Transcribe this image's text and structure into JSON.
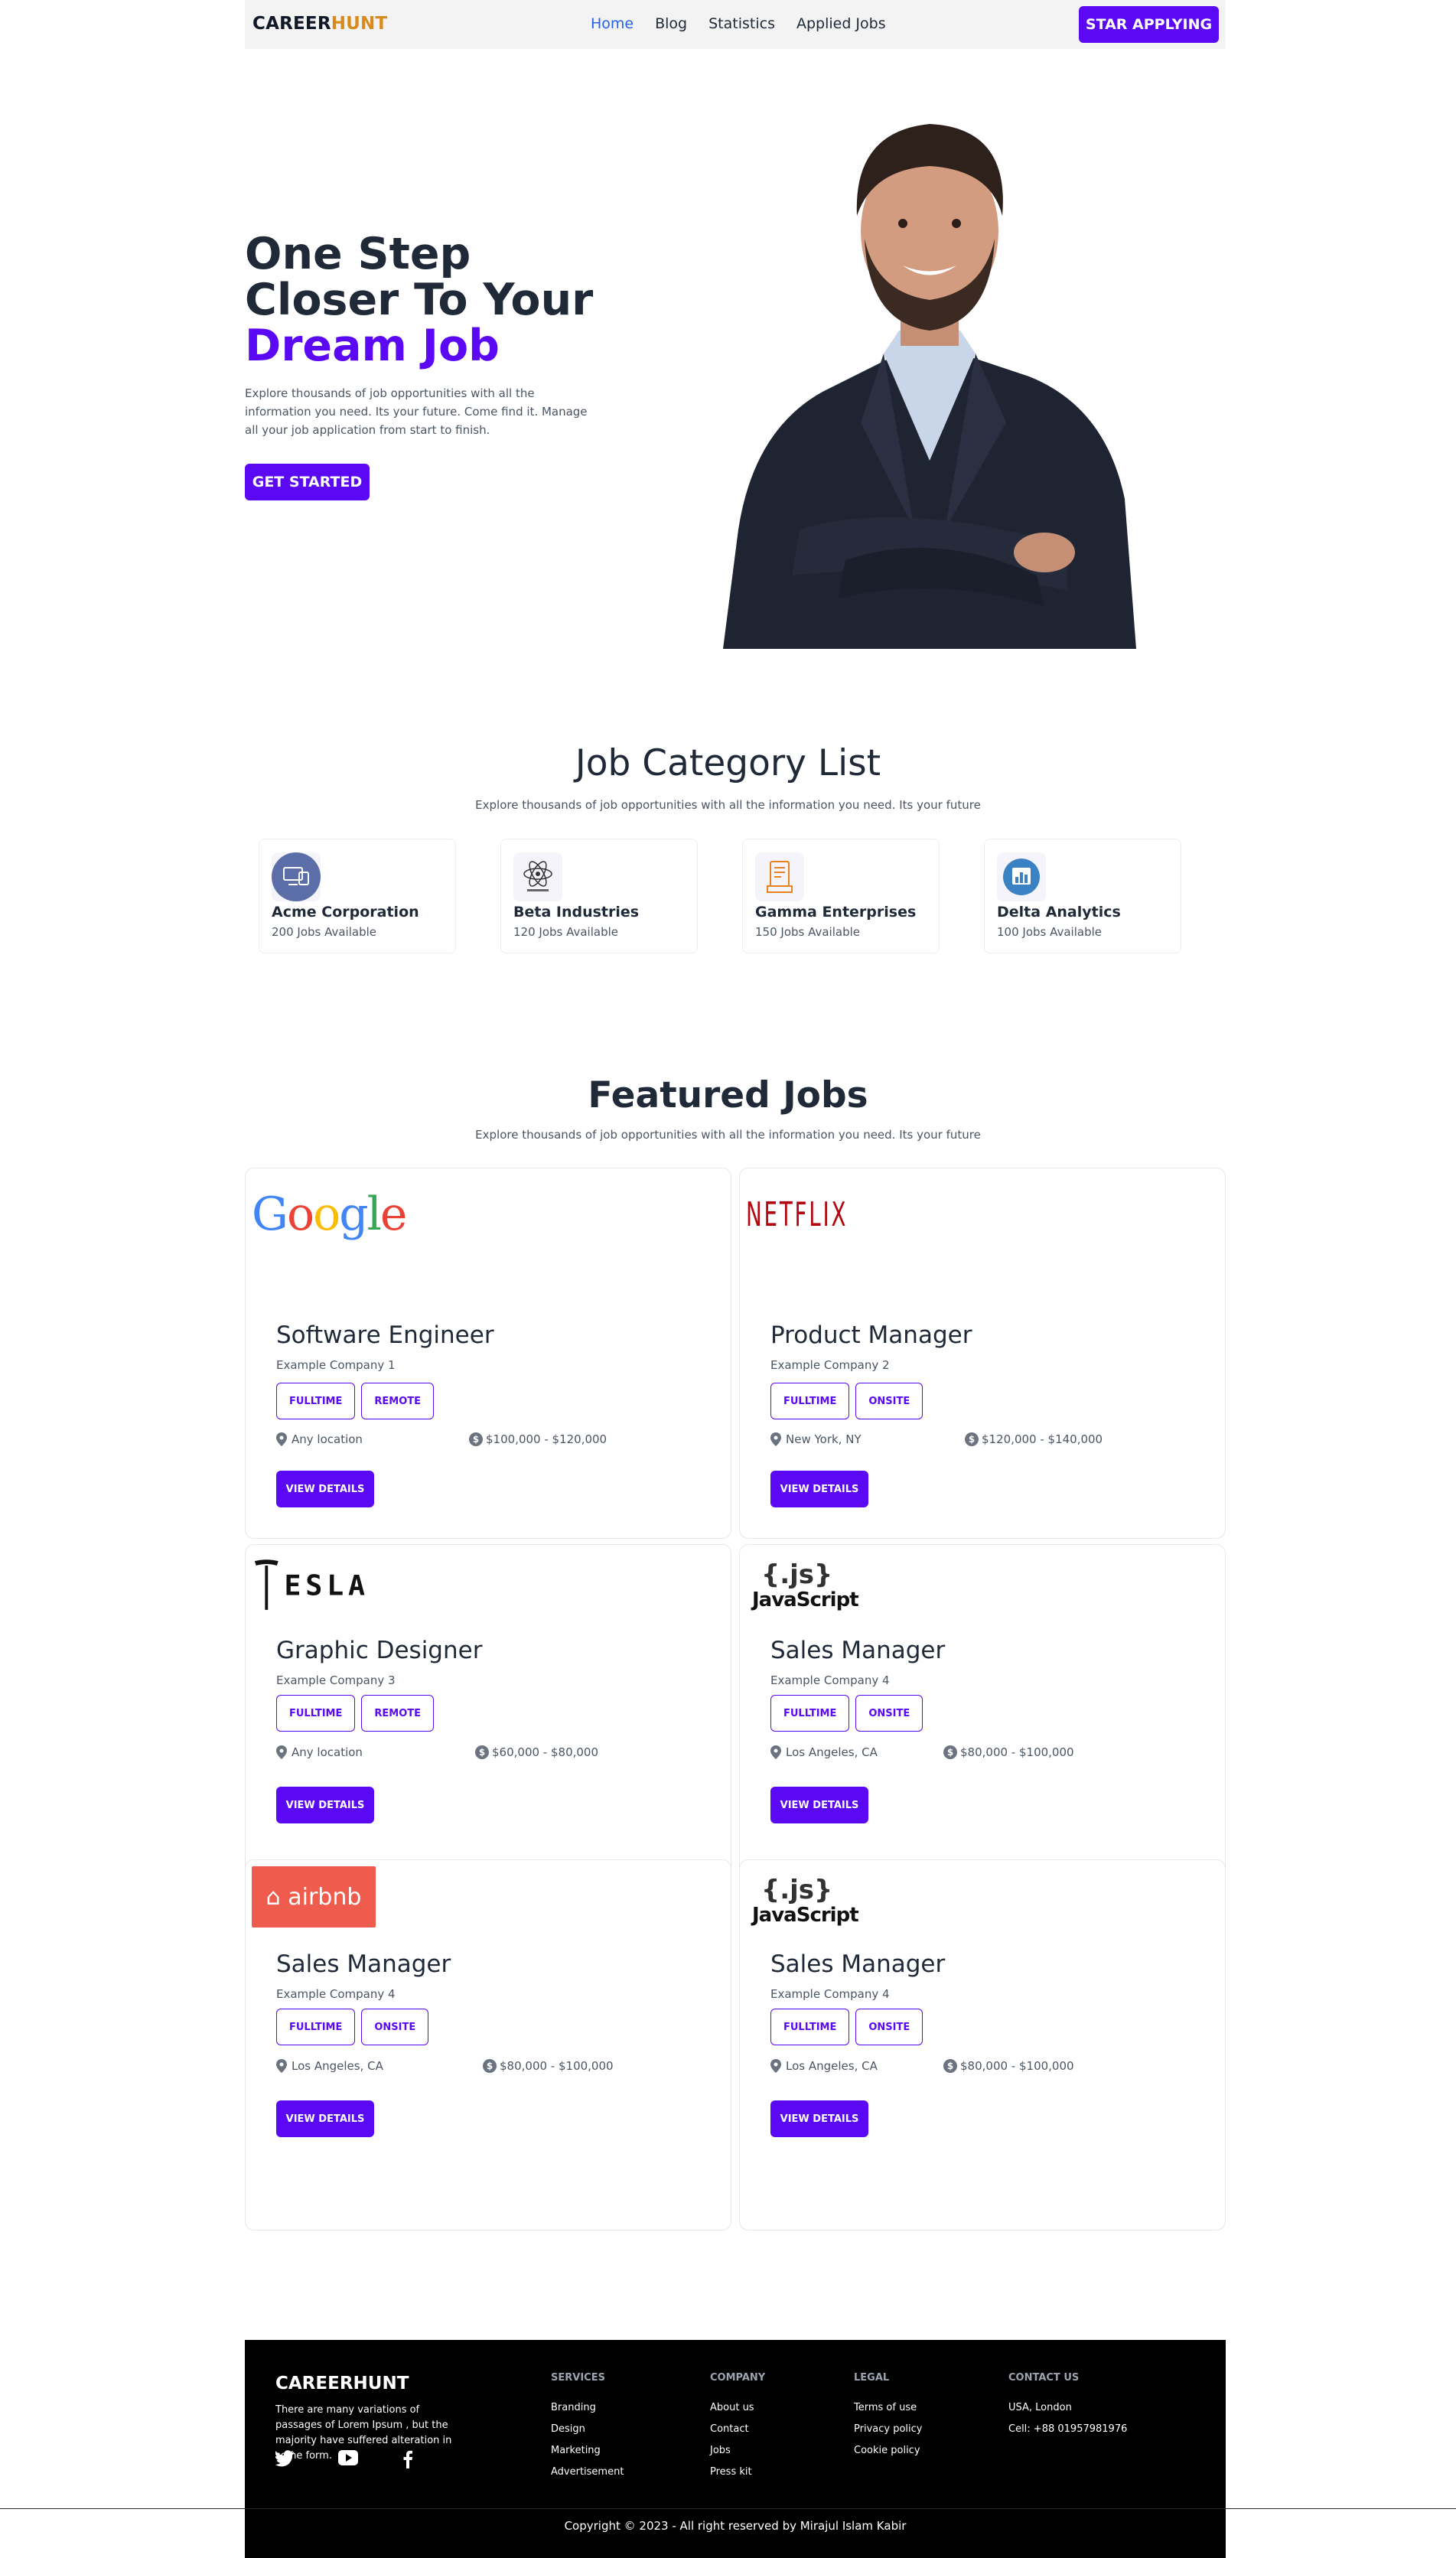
{
  "nav": {
    "logo_part1": "CAREER",
    "logo_part2": "HUNT",
    "links": [
      "Home",
      "Blog",
      "Statistics",
      "Applied Jobs"
    ],
    "cta": "STAR APPLYING"
  },
  "hero": {
    "title_line1": "One Step",
    "title_line2": "Closer To Your",
    "title_accent": "Dream Job",
    "description": "Explore thousands of job opportunities with all the information you need. Its your future. Come find it. Manage all your job application from start to finish.",
    "cta": "GET STARTED"
  },
  "categories": {
    "title": "Job Category List",
    "subtitle": "Explore thousands of job opportunities with all the information you need. Its your future",
    "items": [
      {
        "name": "Acme Corporation",
        "count": "200 Jobs Available",
        "icon": "monitor-icon"
      },
      {
        "name": "Beta Industries",
        "count": "120 Jobs Available",
        "icon": "atom-icon"
      },
      {
        "name": "Gamma Enterprises",
        "count": "150 Jobs Available",
        "icon": "document-icon"
      },
      {
        "name": "Delta Analytics",
        "count": "100 Jobs Available",
        "icon": "chart-icon"
      }
    ]
  },
  "featured": {
    "title": "Featured Jobs",
    "subtitle": "Explore thousands of job opportunities with all the information you need. Its your future",
    "details_label": "VIEW DETAILS",
    "jobs": [
      {
        "logo": "Google",
        "title": "Software Engineer",
        "company": "Example Company 1",
        "tags": [
          "FULLTIME",
          "REMOTE"
        ],
        "location": "Any location",
        "salary": "$100,000 - $120,000"
      },
      {
        "logo": "NETFLIX",
        "title": "Product Manager",
        "company": "Example Company 2",
        "tags": [
          "FULLTIME",
          "ONSITE"
        ],
        "location": "New York, NY",
        "salary": "$120,000 - $140,000"
      },
      {
        "logo": "TESLA",
        "title": "Graphic Designer",
        "company": "Example Company 3",
        "tags": [
          "FULLTIME",
          "REMOTE"
        ],
        "location": "Any location",
        "salary": "$60,000 - $80,000"
      },
      {
        "logo": "{.js} JavaScript",
        "title": "Sales Manager",
        "company": "Example Company 4",
        "tags": [
          "FULLTIME",
          "ONSITE"
        ],
        "location": "Los Angeles, CA",
        "salary": "$80,000 - $100,000"
      },
      {
        "logo": "airbnb",
        "title": "Sales Manager",
        "company": "Example Company 4",
        "tags": [
          "FULLTIME",
          "ONSITE"
        ],
        "location": "Los Angeles, CA",
        "salary": "$80,000 - $100,000"
      },
      {
        "logo": "{.js} JavaScript",
        "title": "Sales Manager",
        "company": "Example Company 4",
        "tags": [
          "FULLTIME",
          "ONSITE"
        ],
        "location": "Los Angeles, CA",
        "salary": "$80,000 - $100,000"
      }
    ]
  },
  "footer": {
    "brand": "CAREERHUNT",
    "description": "There are many variations of passages of Lorem Ipsum , but the majority have suffered alteration in some form.",
    "columns": [
      {
        "heading": "SERVICES",
        "items": [
          "Branding",
          "Design",
          "Marketing",
          "Advertisement"
        ]
      },
      {
        "heading": "COMPANY",
        "items": [
          "About us",
          "Contact",
          "Jobs",
          "Press kit"
        ]
      },
      {
        "heading": "LEGAL",
        "items": [
          "Terms of use",
          "Privacy policy",
          "Cookie policy"
        ]
      },
      {
        "heading": "CONTACT US",
        "items": [
          "USA, London",
          "Cell: +88 01957981976"
        ]
      }
    ],
    "social": [
      "twitter-icon",
      "youtube-icon",
      "facebook-icon"
    ],
    "copyright": "Copyright © 2023 - All right reserved by Mirajul Islam Kabir"
  },
  "colors": {
    "accent": "#5b08f5",
    "brand_orange": "#d98a1c",
    "footer_bg": "#000000"
  }
}
